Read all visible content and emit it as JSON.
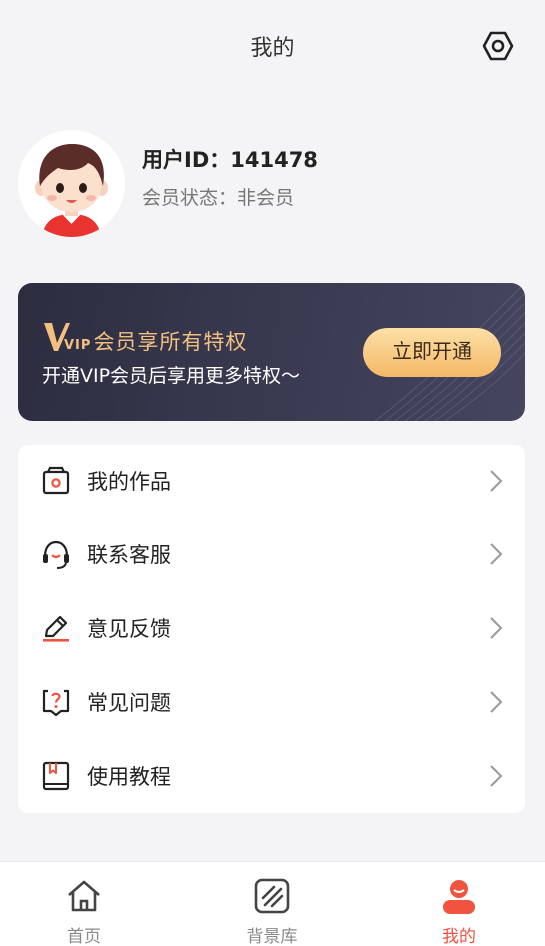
{
  "header": {
    "title": "我的"
  },
  "profile": {
    "user_id": "用户ID：141478",
    "member_status": "会员状态：非会员"
  },
  "vip": {
    "logo_text": "VIP",
    "title": "会员享所有特权",
    "subtitle": "开通VIP会员后享用更多特权～",
    "button": "立即开通"
  },
  "menu": {
    "items": [
      {
        "label": "我的作品",
        "icon": "works-icon"
      },
      {
        "label": "联系客服",
        "icon": "headset-icon"
      },
      {
        "label": "意见反馈",
        "icon": "pencil-icon"
      },
      {
        "label": "常见问题",
        "icon": "question-icon"
      },
      {
        "label": "使用教程",
        "icon": "book-icon"
      }
    ]
  },
  "tabbar": {
    "tabs": [
      {
        "label": "首页",
        "icon": "home-icon",
        "active": false
      },
      {
        "label": "背景库",
        "icon": "background-icon",
        "active": false
      },
      {
        "label": "我的",
        "icon": "profile-icon",
        "active": true
      }
    ]
  },
  "colors": {
    "accent": "#f0533f",
    "gold": "#f4c07f",
    "vip_bg": "#2d2d40"
  }
}
